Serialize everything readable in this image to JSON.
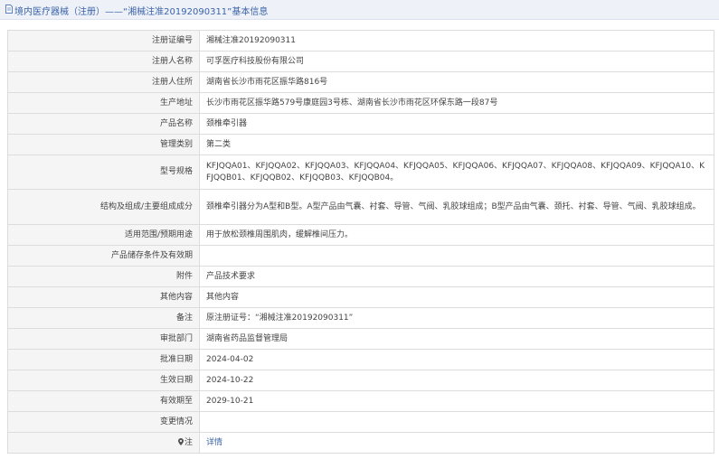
{
  "header": {
    "title": "境内医疗器械（注册）——“湘械注准20192090311”基本信息"
  },
  "rows": [
    {
      "label": "注册证编号",
      "value": "湘械注准20192090311"
    },
    {
      "label": "注册人名称",
      "value": "可孚医疗科技股份有限公司"
    },
    {
      "label": "注册人住所",
      "value": "湖南省长沙市雨花区振华路816号"
    },
    {
      "label": "生产地址",
      "value": "长沙市雨花区振华路579号康庭园3号栋、湖南省长沙市雨花区环保东路一段87号"
    },
    {
      "label": "产品名称",
      "value": "颈椎牵引器"
    },
    {
      "label": "管理类别",
      "value": "第二类"
    },
    {
      "label": "型号规格",
      "value": "KFJQQA01、KFJQQA02、KFJQQA03、KFJQQA04、KFJQQA05、KFJQQA06、KFJQQA07、KFJQQA08、KFJQQA09、KFJQQA10、KFJQQB01、KFJQQB02、KFJQQB03、KFJQQB04。"
    },
    {
      "label": "结构及组成/主要组成成分",
      "value": "颈椎牵引器分为A型和B型。A型产品由气囊、衬套、导管、气阀、乳胶球组成；B型产品由气囊、颈托、衬套、导管、气阀、乳胶球组成。"
    },
    {
      "label": "适用范围/预期用途",
      "value": "用于放松颈椎周围肌肉，缓解椎间压力。"
    },
    {
      "label": "产品储存条件及有效期",
      "value": ""
    },
    {
      "label": "附件",
      "value": "产品技术要求"
    },
    {
      "label": "其他内容",
      "value": "其他内容"
    },
    {
      "label": "备注",
      "value": "原注册证号：“湘械注准20192090311”"
    },
    {
      "label": "审批部门",
      "value": "湖南省药品监督管理局"
    },
    {
      "label": "批准日期",
      "value": "2024-04-02"
    },
    {
      "label": "生效日期",
      "value": "2024-10-22"
    },
    {
      "label": "有效期至",
      "value": "2029-10-21"
    },
    {
      "label": "变更情况",
      "value": ""
    },
    {
      "label": "注",
      "value": "详情"
    }
  ]
}
